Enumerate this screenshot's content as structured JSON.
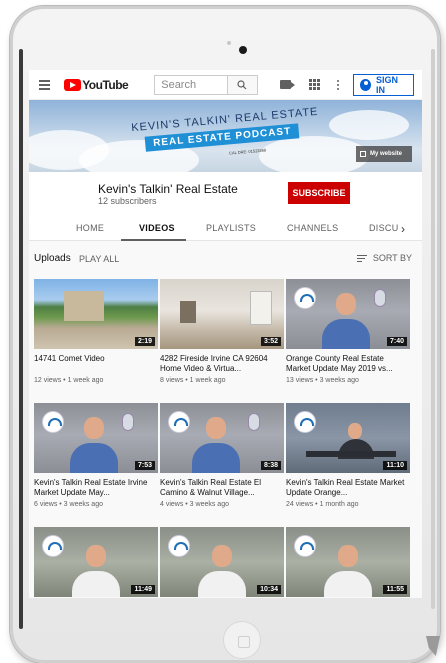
{
  "topbar": {
    "logo_text": "YouTube",
    "search_placeholder": "Search",
    "signin_label": "SIGN IN"
  },
  "banner": {
    "title": "KEVIN'S TALKIN' REAL ESTATE",
    "subtitle": "REAL ESTATE PODCAST",
    "license": "CAL DRE: 01522868",
    "website_link": "My website"
  },
  "channel": {
    "name": "Kevin's Talkin' Real Estate",
    "subscribers": "12 subscribers",
    "subscribe_label": "SUBSCRIBE"
  },
  "tabs": [
    {
      "label": "HOME"
    },
    {
      "label": "VIDEOS"
    },
    {
      "label": "PLAYLISTS"
    },
    {
      "label": "CHANNELS"
    },
    {
      "label": "DISCU"
    }
  ],
  "uploads": {
    "label": "Uploads",
    "play_all": "PLAY ALL",
    "sort_by": "SORT BY"
  },
  "videos": [
    {
      "title": "14741 Comet Video",
      "meta": "12 views • 1 week ago",
      "duration": "2:19"
    },
    {
      "title": "4282 Fireside Irvine CA 92604 Home Video & Virtua...",
      "meta": "8 views • 1 week ago",
      "duration": "3:52"
    },
    {
      "title": "Orange County Real Estate Market Update May 2019 vs...",
      "meta": "13 views • 3 weeks ago",
      "duration": "7:40"
    },
    {
      "title": "Kevin's Talkin Real Estate Irvine Market Update May...",
      "meta": "6 views • 3 weeks ago",
      "duration": "7:53"
    },
    {
      "title": "Kevin's Talkin Real Estate El Camino & Walnut Village...",
      "meta": "4 views • 3 weeks ago",
      "duration": "8:38"
    },
    {
      "title": "Kevin's Talkin Real Estate Market Update Orange...",
      "meta": "24 views • 1 month ago",
      "duration": "11:10"
    },
    {
      "title": "",
      "meta": "",
      "duration": "11:49"
    },
    {
      "title": "",
      "meta": "",
      "duration": "10:34"
    },
    {
      "title": "",
      "meta": "",
      "duration": "11:55"
    }
  ],
  "colors": {
    "youtube_red": "#ff0000",
    "subscribe_red": "#cc0000",
    "link_blue": "#065fd4"
  }
}
